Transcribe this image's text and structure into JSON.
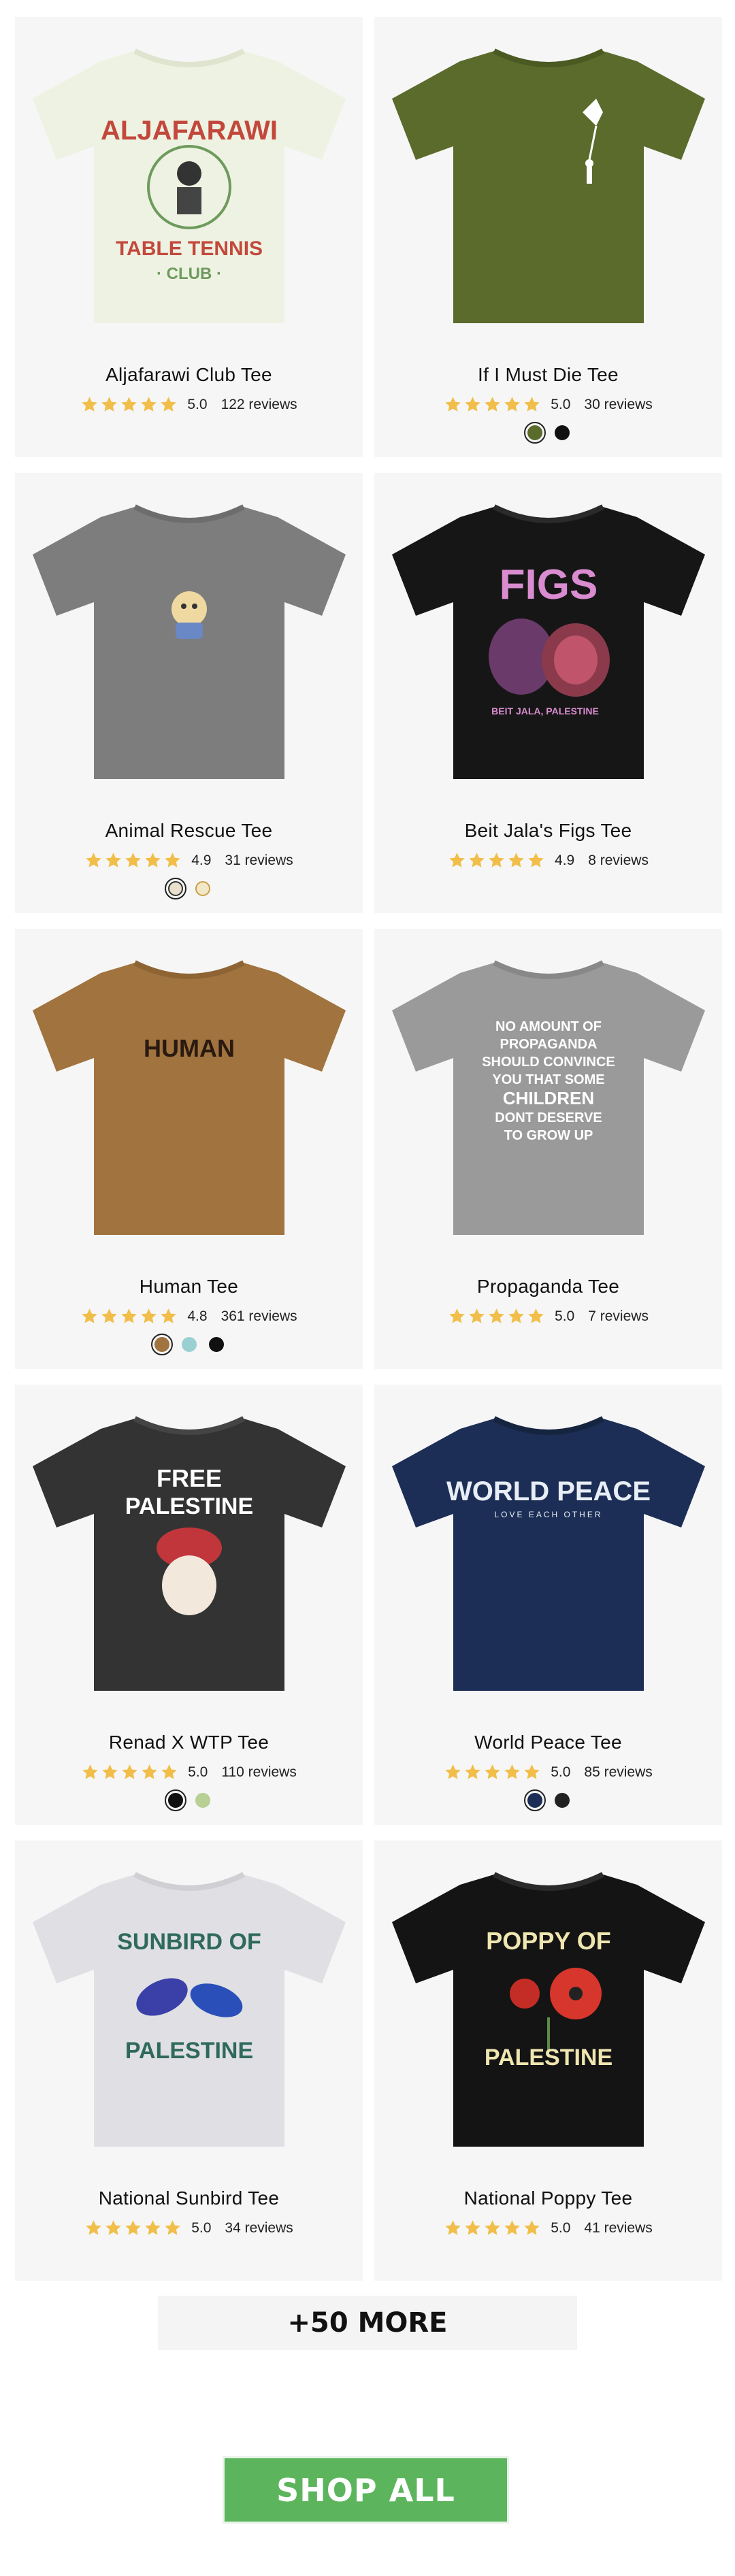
{
  "products": [
    {
      "title": "Aljafarawi Club Tee",
      "rating": "5.0",
      "reviews": "122 reviews",
      "print_text": [
        "ALJAFARAWI",
        "TABLE TENNIS",
        "· CLUB ·"
      ],
      "swatches": []
    },
    {
      "title": "If I Must Die Tee",
      "rating": "5.0",
      "reviews": "30 reviews",
      "print_text": [],
      "swatches": [
        "#5a6b2c",
        "#111111"
      ]
    },
    {
      "title": "Animal Rescue Tee",
      "rating": "4.9",
      "reviews": "31 reviews",
      "print_text": [],
      "swatches": [
        "#e8e0cc",
        "#f2e7c6"
      ]
    },
    {
      "title": "Beit Jala's Figs Tee",
      "rating": "4.9",
      "reviews": "8 reviews",
      "print_text": [
        "FIGS",
        "BEIT JALA, PALESTINE"
      ],
      "swatches": []
    },
    {
      "title": "Human Tee",
      "rating": "4.8",
      "reviews": "361 reviews",
      "print_text": [
        "HUMAN"
      ],
      "swatches": [
        "#a0733f",
        "#9ad0d2",
        "#111111"
      ]
    },
    {
      "title": "Propaganda Tee",
      "rating": "5.0",
      "reviews": "7 reviews",
      "print_text": [
        "NO AMOUNT OF",
        "PROPAGANDA",
        "SHOULD CONVINCE",
        "YOU THAT SOME",
        "CHILDREN",
        "DONT DESERVE",
        "TO GROW UP"
      ],
      "swatches": []
    },
    {
      "title": "Renad X WTP Tee",
      "rating": "5.0",
      "reviews": "110 reviews",
      "print_text": [
        "FREE",
        "PALESTINE"
      ],
      "swatches": [
        "#111111",
        "#b8cf95"
      ]
    },
    {
      "title": "World Peace Tee",
      "rating": "5.0",
      "reviews": "85 reviews",
      "print_text": [
        "WORLD PEACE",
        "LOVE EACH OTHER"
      ],
      "swatches": [
        "#1c2e55",
        "#222222"
      ]
    },
    {
      "title": "National Sunbird Tee",
      "rating": "5.0",
      "reviews": "34 reviews",
      "print_text": [
        "SUNBIRD OF",
        "PALESTINE"
      ],
      "swatches": []
    },
    {
      "title": "National Poppy Tee",
      "rating": "5.0",
      "reviews": "41 reviews",
      "print_text": [
        "POPPY OF",
        "PALESTINE"
      ],
      "swatches": []
    }
  ],
  "more_label": "+50 MORE",
  "shop_all_label": "SHOP ALL",
  "colors": {
    "accent_green": "#5cb55d",
    "star": "#f1be4a"
  }
}
